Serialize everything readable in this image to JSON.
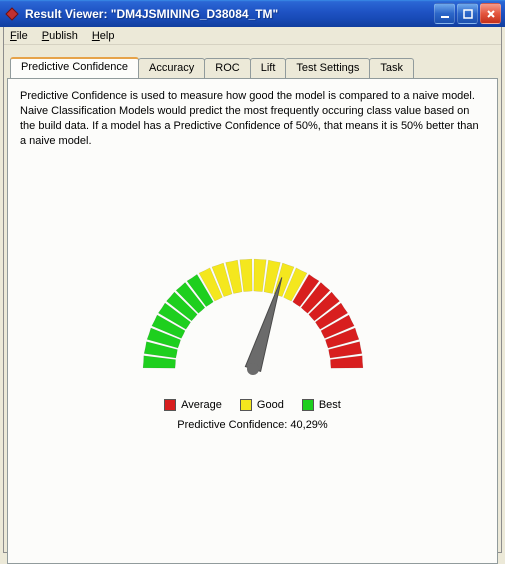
{
  "window": {
    "title": "Result Viewer: \"DM4JSMINING_D38084_TM\""
  },
  "menu": {
    "file": "File",
    "publish": "Publish",
    "help": "Help"
  },
  "tabs": {
    "predictive": "Predictive Confidence",
    "accuracy": "Accuracy",
    "roc": "ROC",
    "lift": "Lift",
    "test": "Test Settings",
    "task": "Task"
  },
  "body": {
    "description": "Predictive Confidence is used to measure how good the model is compared to a naive model. Naive Classification Models would predict the most frequently occuring class value based on the build data. If a model has a Predictive Confidence of 50%, that means it is 50% better than a naive model."
  },
  "legend": {
    "average": "Average",
    "good": "Good",
    "best": "Best"
  },
  "confidence": {
    "label": "Predictive Confidence: 40,29%"
  },
  "chart_data": {
    "type": "gauge",
    "value": 40.29,
    "min": 0,
    "max": 100,
    "zones": [
      {
        "name": "Average",
        "color": "#d81e1e",
        "from": 0,
        "to": 33
      },
      {
        "name": "Good",
        "color": "#f4e71e",
        "from": 33,
        "to": 66
      },
      {
        "name": "Best",
        "color": "#1ecf1e",
        "from": 66,
        "to": 100
      }
    ]
  }
}
